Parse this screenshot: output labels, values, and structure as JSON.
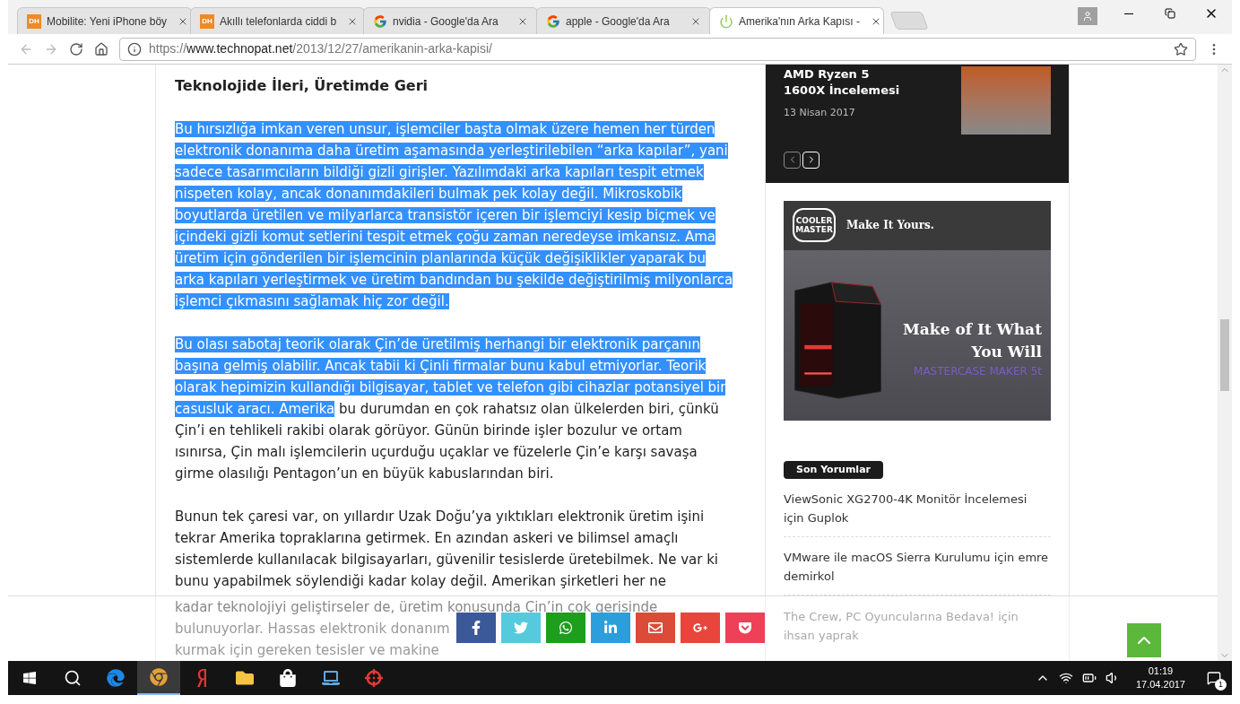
{
  "browser": {
    "tabs": [
      {
        "kind": "dh",
        "favicon_text": "DH",
        "title": "Mobilite: Yeni iPhone böy",
        "selected": false
      },
      {
        "kind": "dh",
        "favicon_text": "DH",
        "title": "Akıllı telefonlarda ciddi b",
        "selected": false
      },
      {
        "kind": "google",
        "title": "nvidia - Google'da Ara",
        "selected": false
      },
      {
        "kind": "google",
        "title": "apple - Google'da Ara",
        "selected": false
      },
      {
        "kind": "loading",
        "title": "Amerika'nın Arka Kapısı -",
        "selected": true
      }
    ],
    "address_bar": {
      "scheme": "https://",
      "host": "www.technopat.net",
      "path": "/2013/12/27/amerikanin-arka-kapisi/"
    }
  },
  "article": {
    "heading": "Teknolojide İleri, Üretimde Geri",
    "paragraphs": [
      [
        {
          "text": "Bu hırsızlığa imkan veren unsur, işlemciler başta olmak üzere hemen her türden elektronik donanıma daha üretim aşamasında yerleştirilebilen “arka kapılar”, yani sadece tasarımcıların bildiği gizli girişler. Yazılımdaki arka kapıları tespit etmek nispeten kolay, ancak donanımdakileri bulmak pek kolay değil. Mikroskobik boyutlarda üretilen ve milyarlarca transistör içeren bir işlemciyi kesip biçmek ve içindeki gizli komut setlerini tespit etmek çoğu zaman neredeyse imkansız. Ama üretim için gönderilen bir işlemcinin planlarında küçük değişiklikler yaparak bu arka kapıları yerleştirmek ve üretim bandından bu şekilde değiştirilmiş milyonlarca işlemci çıkmasını sağlamak hiç zor değil.",
          "selected": true
        }
      ],
      [
        {
          "text": "Bu olası sabotaj teorik olarak Çin’de üretilmiş herhangi bir elektronik parçanın başına gelmiş olabilir. Ancak tabii ki Çinli firmalar bunu kabul etmiyorlar. Teorik olarak hepimizin kullandığı bilgisayar, tablet ve telefon gibi cihazlar potansiyel bir casusluk aracı. Amerika",
          "selected": true
        },
        {
          "text": " bu durumdan en çok rahatsız olan ülkelerden biri, çünkü Çin’i en tehlikeli rakibi olarak görüyor. Günün birinde işler bozulur ve ortam ısınırsa, Çin malı işlemcilerin uçurduğu uçaklar ve füzelerle Çin’e karşı savaşa girme olasılığı Pentagon’un en büyük kabuslarından biri.",
          "selected": false
        }
      ],
      [
        {
          "text": "Bunun tek çaresi var, on yıllardır Uzak Doğu’ya yıktıkları elektronik üretim işini tekrar Amerika topraklarına getirmek. En azından askeri ve bilimsel amaçlı sistemlerde kullanılacak bilgisayarları, güvenilir tesislerde üretebilmek. Ne var ki bunu yapabilmek söylendiği kadar kolay değil. Amerikan şirketleri her ne",
          "selected": false
        }
      ]
    ],
    "faded_lines": [
      "kadar teknolojiyi geliştirseler de, üretim konusunda Çin’in çok gerisinde",
      "bulunuyorlar. Hassas elektronik donanım",
      "kurmak için gereken tesisler ve makine"
    ]
  },
  "sidebar": {
    "featured": {
      "title": "AMD Ryzen 5 1600X İncelemesi",
      "date": "13 Nisan 2017"
    },
    "ad": {
      "logo": "COOLER MASTER",
      "tagline": "Make It Yours.",
      "headline": "Make of It What You Will",
      "product": "MASTERCASE MAKER 5t"
    },
    "comments_heading": "Son Yorumlar",
    "comments": [
      "ViewSonic XG2700-4K Monitör İncelemesi için Guplok",
      "VMware ile macOS Sierra Kurulumu için emre demirkol"
    ],
    "faded_comment": "The Crew, PC Oyuncularına Bedava! için ihsan yaprak"
  },
  "share_buttons": [
    {
      "kind": "facebook",
      "color": "#3b5998"
    },
    {
      "kind": "twitter",
      "color": "#55cadd"
    },
    {
      "kind": "whatsapp",
      "color": "#1d9e1d"
    },
    {
      "kind": "linkedin",
      "color": "#2a9fdc"
    },
    {
      "kind": "email",
      "color": "#dc4a38"
    },
    {
      "kind": "googleplus",
      "color": "#e8453c"
    },
    {
      "kind": "pocket",
      "color": "#ee4056"
    }
  ],
  "taskbar": {
    "apps": [
      {
        "kind": "search",
        "selected": false
      },
      {
        "kind": "edge",
        "selected": false
      },
      {
        "kind": "chrome",
        "selected": true
      },
      {
        "kind": "yandex",
        "selected": false
      },
      {
        "kind": "explorer",
        "selected": false
      },
      {
        "kind": "store",
        "selected": false
      },
      {
        "kind": "laptop",
        "selected": false
      },
      {
        "kind": "red-app",
        "selected": false
      }
    ],
    "time": "01:19",
    "date": "17.04.2017",
    "notifications": "1"
  }
}
